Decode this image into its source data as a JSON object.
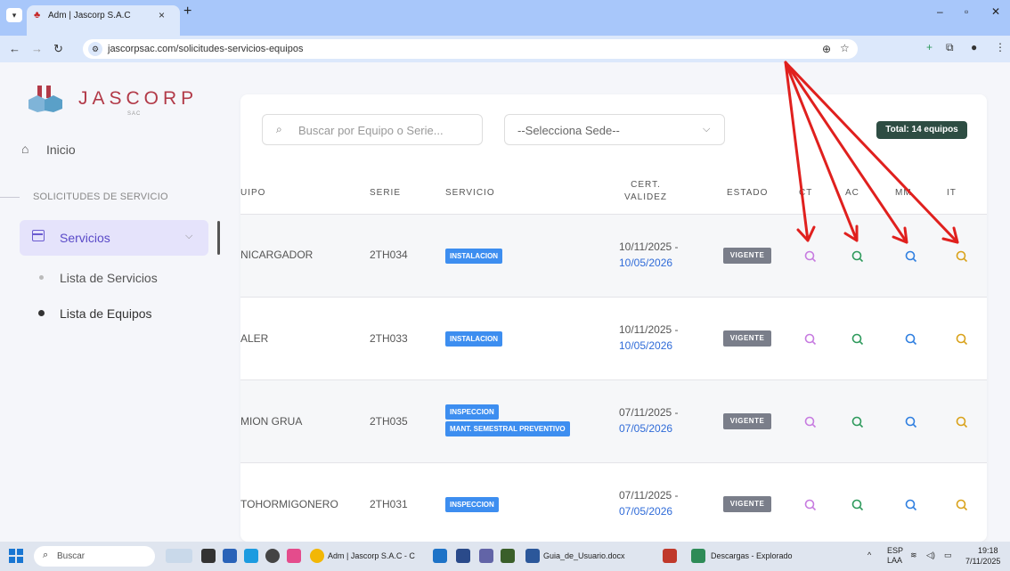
{
  "browser": {
    "tab_title": "Adm | Jascorp S.A.C",
    "tab_close": "×",
    "new_tab": "+",
    "url": "jascorpsac.com/solicitudes-servicios-equipos"
  },
  "sidebar": {
    "brand": "JASCORP",
    "brand_sub": "SAC",
    "home_label": "Inicio",
    "section_label": "SOLICITUDES DE SERVICIO",
    "services_label": "Servicios",
    "sub_items": [
      {
        "label": "Lista de Servicios"
      },
      {
        "label": "Lista de Equipos"
      }
    ]
  },
  "filters": {
    "search_placeholder": "Buscar por Equipo o Serie...",
    "sede_selected": "--Selecciona Sede--",
    "total": "Total: 14 equipos"
  },
  "table": {
    "headers": {
      "equipo": "UIPO",
      "serie": "SERIE",
      "servicio": "SERVICIO",
      "cert_line1": "CERT.",
      "cert_line2": "VALIDEZ",
      "estado": "ESTADO",
      "ct": "CT",
      "ac": "AC",
      "mm": "MM",
      "it": "IT"
    },
    "rows": [
      {
        "equipo": "NICARGADOR",
        "serie": "2TH034",
        "servicios": [
          "INSTALACION"
        ],
        "cert_from": "10/11/2025 -",
        "cert_to": "10/05/2026",
        "estado": "VIGENTE"
      },
      {
        "equipo": "ALER",
        "serie": "2TH033",
        "servicios": [
          "INSTALACION"
        ],
        "cert_from": "10/11/2025 -",
        "cert_to": "10/05/2026",
        "estado": "VIGENTE"
      },
      {
        "equipo": "MION GRUA",
        "serie": "2TH035",
        "servicios": [
          "INSPECCION",
          "MANT. SEMESTRAL PREVENTIVO"
        ],
        "cert_from": "07/11/2025 -",
        "cert_to": "07/05/2026",
        "estado": "VIGENTE"
      },
      {
        "equipo": "TOHORMIGONERO",
        "serie": "2TH031",
        "servicios": [
          "INSPECCION"
        ],
        "cert_from": "07/11/2025 -",
        "cert_to": "07/05/2026",
        "estado": "VIGENTE"
      }
    ],
    "action_colors": {
      "ct": "#c77be0",
      "ac": "#2e9a5c",
      "mm": "#2f7fe0",
      "it": "#d9a21b"
    }
  },
  "taskbar": {
    "search": "Buscar",
    "chrome_label": "Adm | Jascorp S.A.C - C",
    "word_label": "Guia_de_Usuario.docx",
    "explorer_label": "Descargas - Explorado",
    "lang": "ESP",
    "lang_sub": "LAA",
    "time": "19:18",
    "date": "7/11/2025"
  },
  "colors": {
    "accent": "#5a4ac8",
    "arrow": "#e0201e",
    "badge_blue": "#3d8ef0",
    "total_badge": "#2e4d43"
  }
}
